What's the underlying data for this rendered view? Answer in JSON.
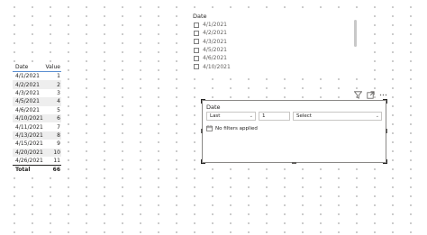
{
  "table": {
    "headers": [
      "Date",
      "Value"
    ],
    "rows": [
      {
        "date": "4/1/2021",
        "value": "1"
      },
      {
        "date": "4/2/2021",
        "value": "2"
      },
      {
        "date": "4/3/2021",
        "value": "3"
      },
      {
        "date": "4/5/2021",
        "value": "4"
      },
      {
        "date": "4/6/2021",
        "value": "5"
      },
      {
        "date": "4/10/2021",
        "value": "6"
      },
      {
        "date": "4/11/2021",
        "value": "7"
      },
      {
        "date": "4/13/2021",
        "value": "8"
      },
      {
        "date": "4/15/2021",
        "value": "9"
      },
      {
        "date": "4/20/2021",
        "value": "10"
      },
      {
        "date": "4/26/2021",
        "value": "11"
      }
    ],
    "total_label": "Total",
    "total_value": "66"
  },
  "slicer": {
    "title": "Date",
    "items": [
      "4/1/2021",
      "4/2/2021",
      "4/3/2021",
      "4/5/2021",
      "4/6/2021",
      "4/10/2021"
    ]
  },
  "visual_header": {
    "icons": [
      "filter-icon",
      "focus-mode-icon",
      "more-options-icon"
    ]
  },
  "filter_card": {
    "title": "Date",
    "anchor_value": "Last",
    "count_value": "1",
    "period_value": "Select",
    "status_text": "No filters applied"
  },
  "colors": {
    "header_underline": "#5b8fd1",
    "row_alt": "#eeeeee",
    "border": "#8a8886"
  }
}
